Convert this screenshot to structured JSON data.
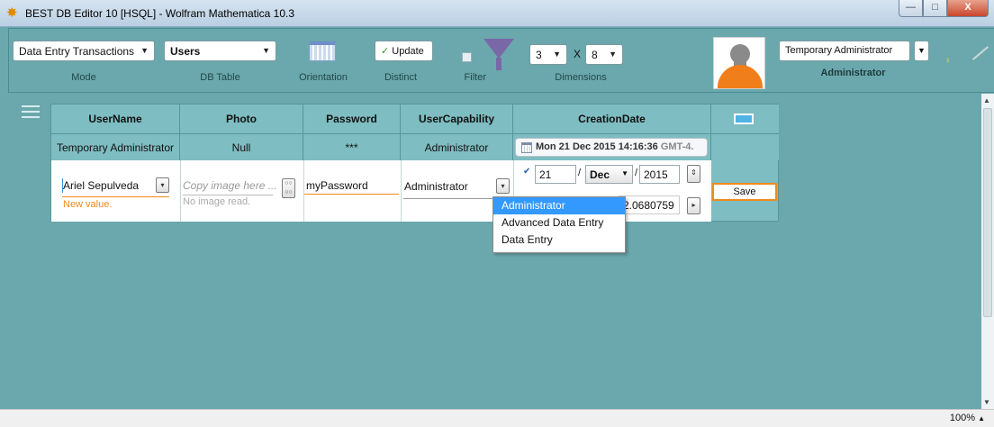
{
  "window": {
    "title": "BEST DB Editor 10 [HSQL] - Wolfram Mathematica 10.3",
    "buttons": {
      "minimize": "—",
      "maximize": "□",
      "close": "X"
    }
  },
  "toolbar": {
    "mode": {
      "value": "Data Entry Transactions",
      "caption": "Mode"
    },
    "table": {
      "value": "Users",
      "caption": "DB Table"
    },
    "orientation": {
      "caption": "Orientation"
    },
    "distinct": {
      "label": "Update",
      "check": "✓",
      "caption": "Distinct"
    },
    "filter": {
      "caption": "Filter"
    },
    "dimensions": {
      "rows": "3",
      "x": "X",
      "cols": "8",
      "caption": "Dimensions"
    },
    "user": {
      "value": "Temporary Administrator",
      "role": "Administrator"
    }
  },
  "grid": {
    "columns": [
      "UserName",
      "Photo",
      "Password",
      "UserCapability",
      "CreationDate"
    ],
    "existing_row": {
      "username": "Temporary Administrator",
      "photo": "Null",
      "password": "***",
      "capability": "Administrator",
      "creation_date": "Mon 21 Dec 2015 14:16:36",
      "creation_tz": "GMT-4."
    },
    "edit_row": {
      "username": "Ariel Sepulveda",
      "username_note": "New value.",
      "photo_placeholder": "Copy image here ...",
      "photo_status": "No image read.",
      "password": "myPassword",
      "capability": "Administrator",
      "day": "21",
      "month": "Dec",
      "year": "2015",
      "time_fraction": "2.0680759",
      "save_label": "Save"
    }
  },
  "capability_options": [
    "Administrator",
    "Advanced Data Entry",
    "Data Entry"
  ],
  "status": {
    "zoom": "100%"
  },
  "colors": {
    "background": "#6aa8ad",
    "grid": "#7ebdc2",
    "accent": "#f28a1a",
    "selection": "#3399ff"
  }
}
